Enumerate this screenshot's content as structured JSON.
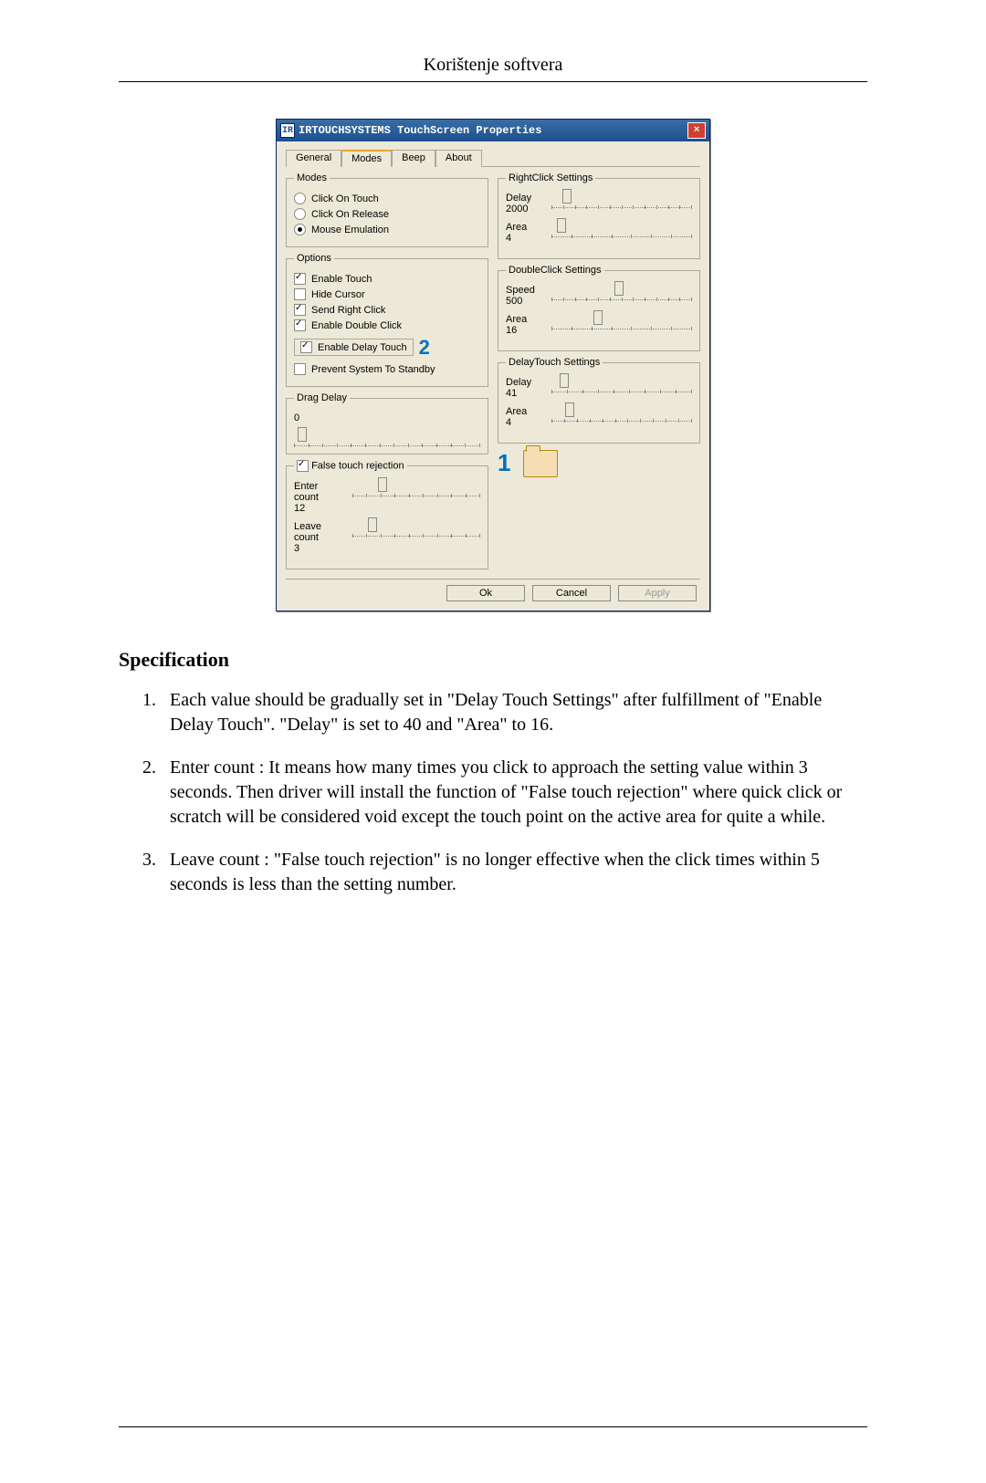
{
  "page_header": "Korištenje softvera",
  "window": {
    "title": "IRTOUCHSYSTEMS TouchScreen Properties",
    "tabs": [
      "General",
      "Modes",
      "Beep",
      "About"
    ],
    "active_tab": "Modes",
    "modes_group_label": "Modes",
    "modes": {
      "click_on_touch": "Click On Touch",
      "click_on_release": "Click On Release",
      "mouse_emulation": "Mouse Emulation",
      "selected": "mouse_emulation"
    },
    "options_group_label": "Options",
    "options": {
      "enable_touch": {
        "label": "Enable Touch",
        "checked": true
      },
      "hide_cursor": {
        "label": "Hide Cursor",
        "checked": false
      },
      "send_right_click": {
        "label": "Send Right Click",
        "checked": true
      },
      "enable_double_click": {
        "label": "Enable Double Click",
        "checked": true
      },
      "enable_delay_touch": {
        "label": "Enable Delay Touch",
        "checked": true
      },
      "prevent_standby": {
        "label": "Prevent System To Standby",
        "checked": false
      }
    },
    "drag_delay": {
      "label": "Drag Delay",
      "value": "0"
    },
    "false_touch": {
      "label": "False touch rejection",
      "checked": true,
      "enter_count": {
        "label": "Enter count",
        "value": "12"
      },
      "leave_count": {
        "label": "Leave count",
        "value": "3"
      }
    },
    "right_click": {
      "label": "RightClick Settings",
      "delay": {
        "label": "Delay",
        "value": "2000"
      },
      "area": {
        "label": "Area",
        "value": "4"
      }
    },
    "double_click": {
      "label": "DoubleClick Settings",
      "speed": {
        "label": "Speed",
        "value": "500"
      },
      "area": {
        "label": "Area",
        "value": "16"
      }
    },
    "delay_touch": {
      "label": "DelayTouch Settings",
      "delay": {
        "label": "Delay",
        "value": "41"
      },
      "area": {
        "label": "Area",
        "value": "4"
      }
    },
    "buttons": {
      "ok": "Ok",
      "cancel": "Cancel",
      "apply": "Apply"
    },
    "annotations": {
      "one": "1",
      "two": "2"
    }
  },
  "spec_heading": "Specification",
  "spec_items": [
    "Each value should be gradually set in \"Delay Touch Settings\" after fulfillment of \"Enable Delay Touch\". \"Delay\" is set to 40 and \"Area\" to 16.",
    "Enter count : It means how many times you click to approach the setting value within 3 seconds. Then driver will install the function of \"False touch rejection\" where quick click or scratch will be considered void except the touch point on the active area for quite a while.",
    "Leave count : \"False touch rejection\" is no longer effective when the click times within 5 seconds is less than the setting number."
  ]
}
